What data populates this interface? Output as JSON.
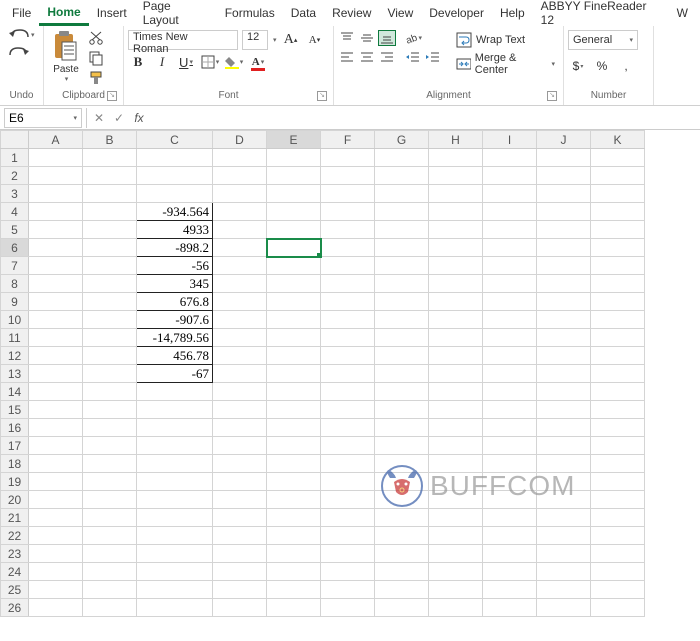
{
  "menu": {
    "tabs": [
      "File",
      "Home",
      "Insert",
      "Page Layout",
      "Formulas",
      "Data",
      "Review",
      "View",
      "Developer",
      "Help",
      "ABBYY FineReader 12",
      "W"
    ],
    "active_index": 1
  },
  "ribbon": {
    "undo": {
      "label": "Undo"
    },
    "clipboard": {
      "label": "Clipboard",
      "paste": "Paste"
    },
    "font": {
      "label": "Font",
      "name": "Times New Roman",
      "size": "12",
      "bold": "B",
      "italic": "I",
      "underline": "U",
      "increase": "A",
      "decrease": "A"
    },
    "alignment": {
      "label": "Alignment",
      "wrap": "Wrap Text",
      "merge": "Merge & Center"
    },
    "number": {
      "label": "Number",
      "format": "General",
      "currency": "$",
      "percent": "%",
      "comma": ","
    }
  },
  "formula_bar": {
    "cell_ref": "E6",
    "formula": ""
  },
  "grid": {
    "columns": [
      "A",
      "B",
      "C",
      "D",
      "E",
      "F",
      "G",
      "H",
      "I",
      "J",
      "K"
    ],
    "row_count": 26,
    "selected_cell": "E6",
    "active_col": "E",
    "active_row": 6,
    "data": {
      "C4": "-934.564",
      "C5": "4933",
      "C6": "-898.2",
      "C7": "-56",
      "C8": "345",
      "C9": "676.8",
      "C10": "-907.6",
      "C11": "-14,789.56",
      "C12": "456.78",
      "C13": "-67"
    }
  },
  "watermark": {
    "text": "BUFFCOM"
  }
}
